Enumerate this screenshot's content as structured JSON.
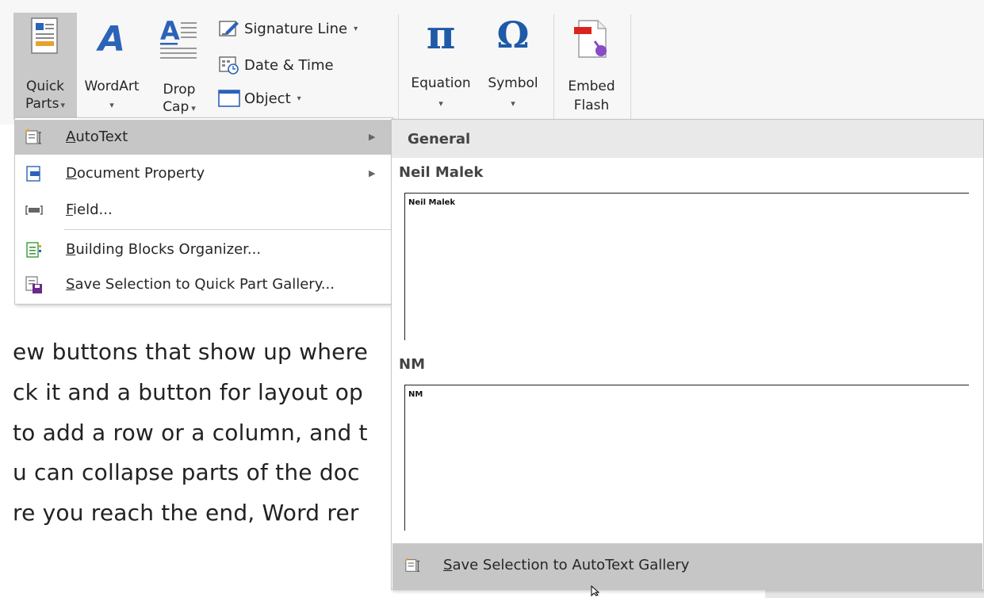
{
  "ribbon": {
    "quick_parts": {
      "line1": "Quick",
      "line2": "Parts",
      "caret": "▾"
    },
    "wordart": {
      "label": "WordArt",
      "caret": "▾"
    },
    "drop_cap": {
      "line1": "Drop",
      "line2": "Cap",
      "caret": "▾"
    },
    "signature_line": {
      "label": "Signature Line",
      "caret": "▾"
    },
    "date_time": {
      "label": "Date & Time"
    },
    "object": {
      "label": "Object",
      "caret": "▾"
    },
    "equation": {
      "label": "Equation",
      "caret": "▾",
      "glyph": "π"
    },
    "symbol": {
      "label": "Symbol",
      "caret": "▾",
      "glyph": "Ω"
    },
    "embed_flash": {
      "line1": "Embed",
      "line2": "Flash"
    }
  },
  "quick_parts_menu": {
    "items": [
      {
        "label_u": "A",
        "label_rest": "utoText",
        "has_submenu": true,
        "highlighted": true,
        "icon": "autotext-icon"
      },
      {
        "label_u": "D",
        "label_rest": "ocument Property",
        "has_submenu": true,
        "highlighted": false,
        "icon": "document-property-icon"
      },
      {
        "label_u": "F",
        "label_rest": "ield...",
        "has_submenu": false,
        "highlighted": false,
        "icon": "field-icon"
      },
      {
        "label_u": "B",
        "label_rest": "uilding Blocks Organizer...",
        "has_submenu": false,
        "highlighted": false,
        "icon": "building-blocks-icon"
      },
      {
        "label_u": "S",
        "label_rest": "ave Selection to Quick Part Gallery...",
        "has_submenu": false,
        "highlighted": false,
        "icon": "save-quick-part-icon"
      }
    ],
    "arrow": "▶"
  },
  "autotext_gallery": {
    "header": "General",
    "entries": [
      {
        "title": "Neil Malek",
        "preview": "Neil Malek"
      },
      {
        "title": "NM",
        "preview": "NM"
      }
    ],
    "footer_u": "S",
    "footer_rest": "ave Selection to AutoText Gallery"
  },
  "document": {
    "lines": [
      "ew buttons that show up where",
      "ck it and a button for layout op",
      "to add a row or a column, and t",
      "u can collapse parts of the doc",
      "re you reach the end, Word rer"
    ]
  },
  "colors": {
    "ribbon_bg": "#f7f7f7",
    "menu_highlight": "#c6c6c6",
    "wordart_blue": "#2b63b8",
    "math_blue": "#1e5aa8",
    "flash_red": "#d9251d",
    "flash_purple": "#8a4bc6"
  }
}
